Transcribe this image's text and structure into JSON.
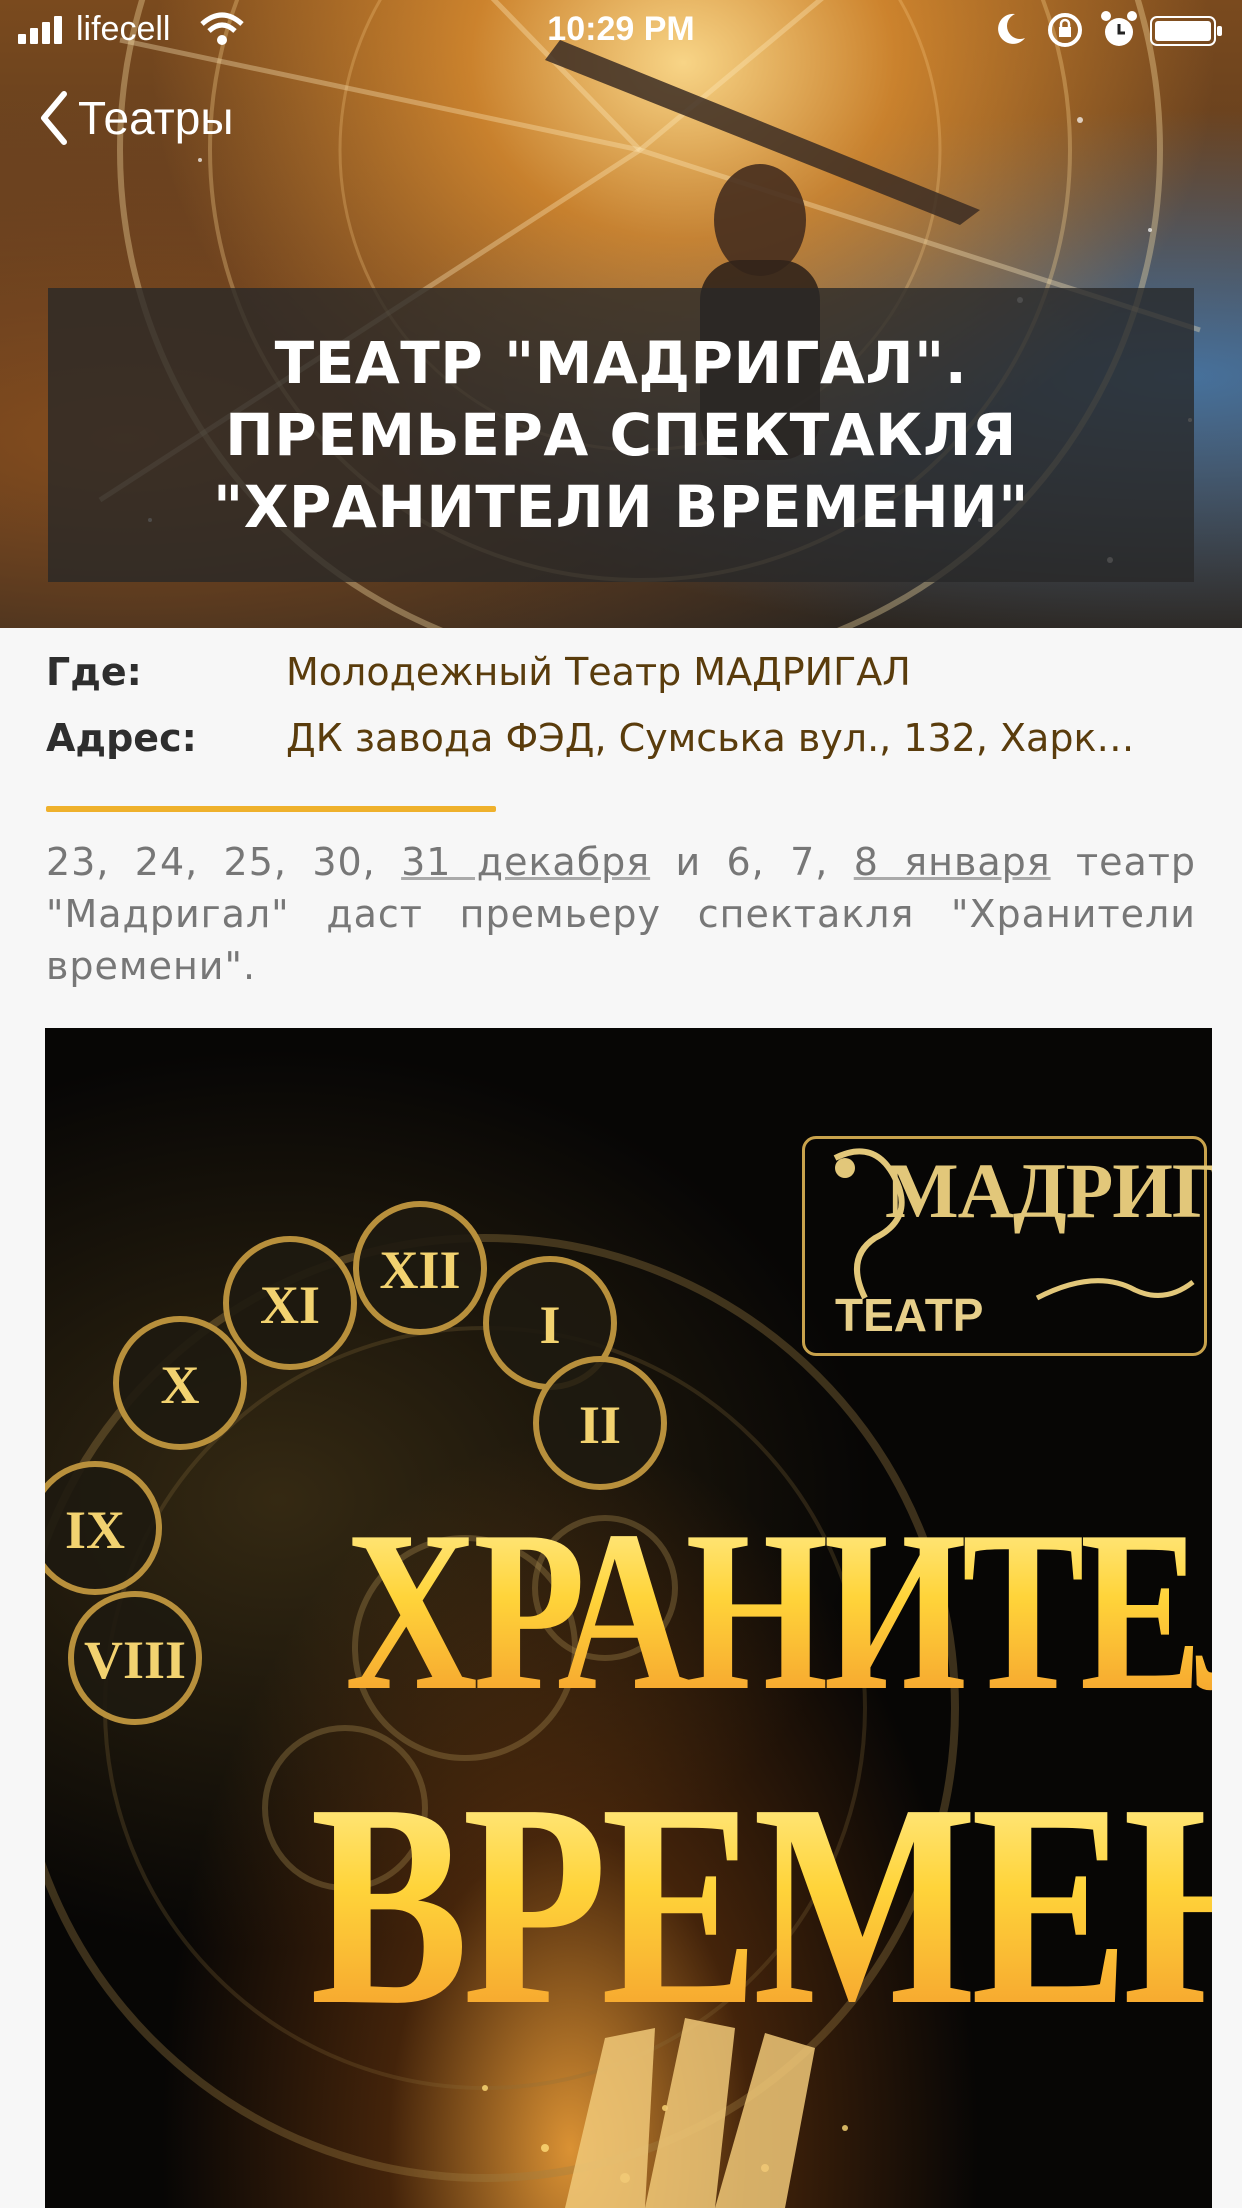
{
  "status_bar": {
    "carrier": "lifecell",
    "time": "10:29 PM"
  },
  "nav": {
    "back_label": "Театры"
  },
  "event": {
    "title": "ТЕАТР \"МАДРИГАЛ\". ПРЕМЬЕРА СПЕКТАКЛЯ \"ХРАНИТЕЛИ ВРЕМЕНИ\"",
    "where_label": "Где:",
    "where_value": "Молодежный Театр МАДРИГАЛ",
    "address_label": "Адрес:",
    "address_value": "ДК завода ФЭД, Сумська вул., 132, Харк…",
    "description": {
      "part1": "23, 24, 25, 30, ",
      "link1": "31 декабря",
      "part2": " и 6, 7, ",
      "link2": "8 января",
      "part3": " театр \"Мадригал\" даст премьеру спектакля \"Хранители времени\"."
    }
  },
  "poster": {
    "logo_name": "МАДРИГАЛ",
    "logo_theatre": "ТЕАТР",
    "title_line1": "ХРАНИТЕЛИ",
    "title_line2": "ВРЕМЕНИ",
    "numerals": [
      "XI",
      "XII",
      "I",
      "X",
      "II",
      "IX",
      "VIII"
    ]
  },
  "colors": {
    "accent": "#efb12c",
    "value_text": "#5a3c0c",
    "label_text": "#2e2e2e",
    "description_text": "#777777"
  }
}
